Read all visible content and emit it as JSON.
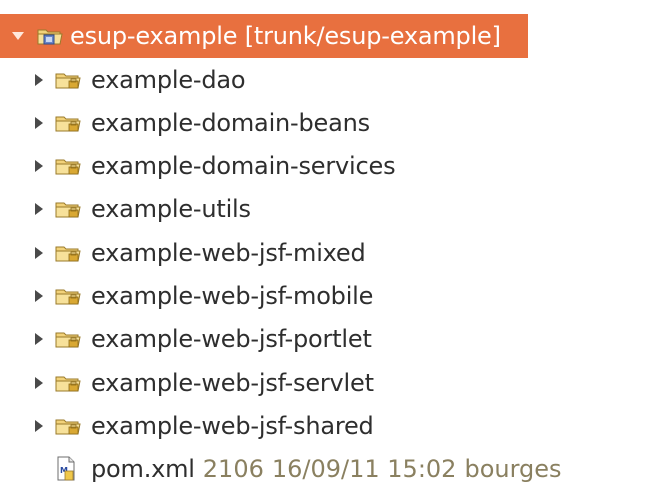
{
  "project": {
    "root": {
      "label": "esup-example [trunk/esup-example]",
      "icon": "project-folder-icon",
      "expanded": true
    },
    "children": [
      {
        "label": "example-dao",
        "icon": "package-folder-icon"
      },
      {
        "label": "example-domain-beans",
        "icon": "package-folder-icon"
      },
      {
        "label": "example-domain-services",
        "icon": "package-folder-icon"
      },
      {
        "label": "example-utils",
        "icon": "package-folder-icon"
      },
      {
        "label": "example-web-jsf-mixed",
        "icon": "package-folder-icon"
      },
      {
        "label": "example-web-jsf-mobile",
        "icon": "package-folder-icon"
      },
      {
        "label": "example-web-jsf-portlet",
        "icon": "package-folder-icon"
      },
      {
        "label": "example-web-jsf-servlet",
        "icon": "package-folder-icon"
      },
      {
        "label": "example-web-jsf-shared",
        "icon": "package-folder-icon"
      }
    ],
    "file": {
      "name": "pom.xml",
      "revision": "2106",
      "date": "16/09/11 15:02",
      "author": "bourges",
      "icon": "xml-file-icon"
    }
  },
  "colors": {
    "selection": "#e8703f",
    "text": "#2e2e2e",
    "meta_text": "#8a8060",
    "folder": "#e8c45a"
  }
}
